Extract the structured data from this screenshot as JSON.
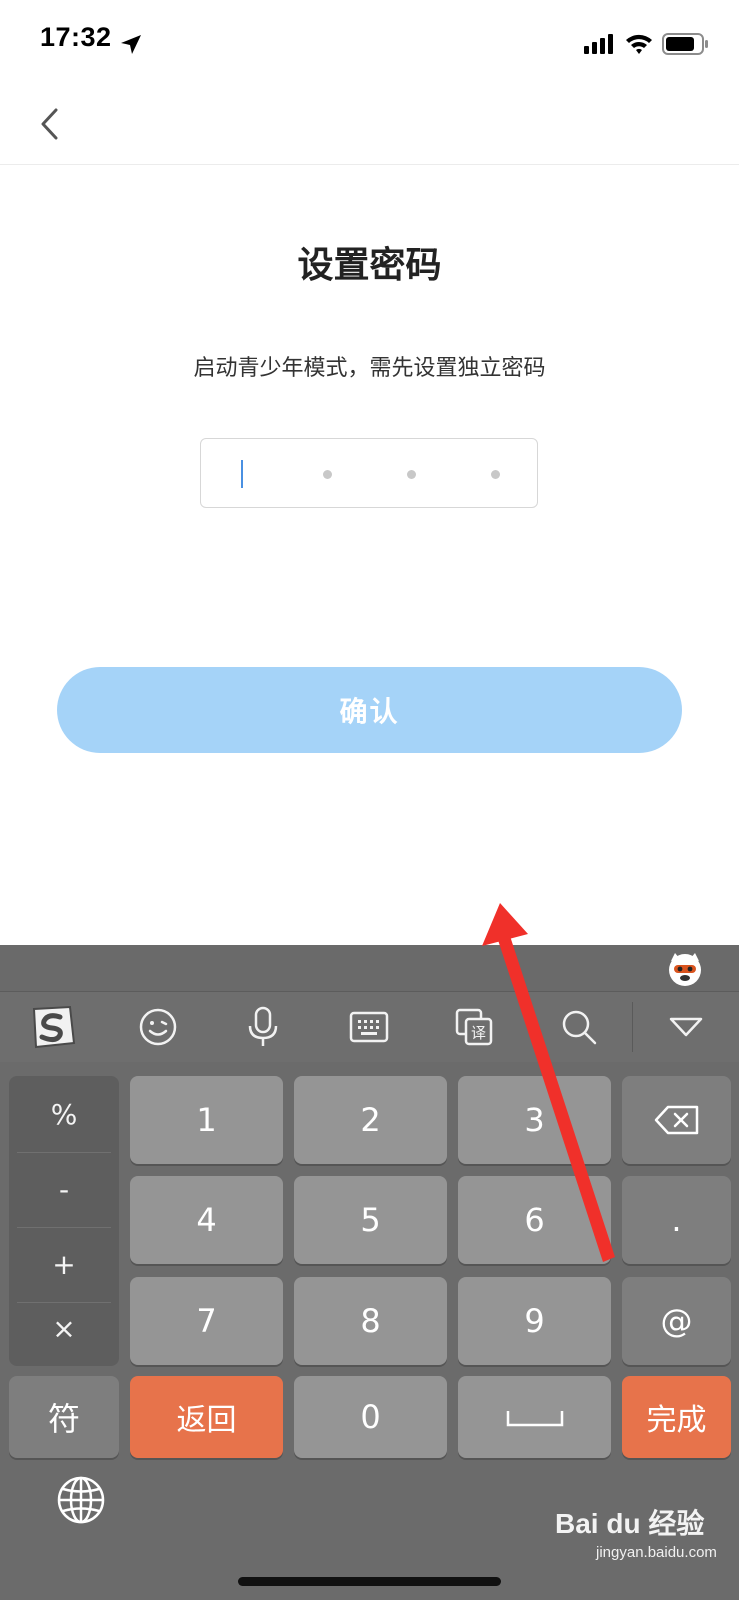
{
  "status_bar": {
    "time": "17:32"
  },
  "page": {
    "title": "设置密码",
    "subtitle": "启动青少年模式，需先设置独立密码",
    "confirm_label": "确认"
  },
  "keyboard": {
    "symbols": [
      "%",
      "-",
      "+",
      "×"
    ],
    "digits": [
      "1",
      "2",
      "3",
      "4",
      "5",
      "6",
      "7",
      "8",
      "9",
      "0"
    ],
    "dot": ".",
    "at": "@",
    "fu": "符",
    "back": "返回",
    "done": "完成",
    "toolbar_icons": [
      "sogou-logo-icon",
      "emoji-icon",
      "microphone-icon",
      "keyboard-icon",
      "translate-icon",
      "search-icon",
      "collapse-icon"
    ]
  },
  "watermark": {
    "brand": "Bai du 经验",
    "url": "jingyan.baidu.com"
  },
  "colors": {
    "accent": "#a5d3f8",
    "orange": "#e7734b",
    "arrow": "#f0302a"
  }
}
